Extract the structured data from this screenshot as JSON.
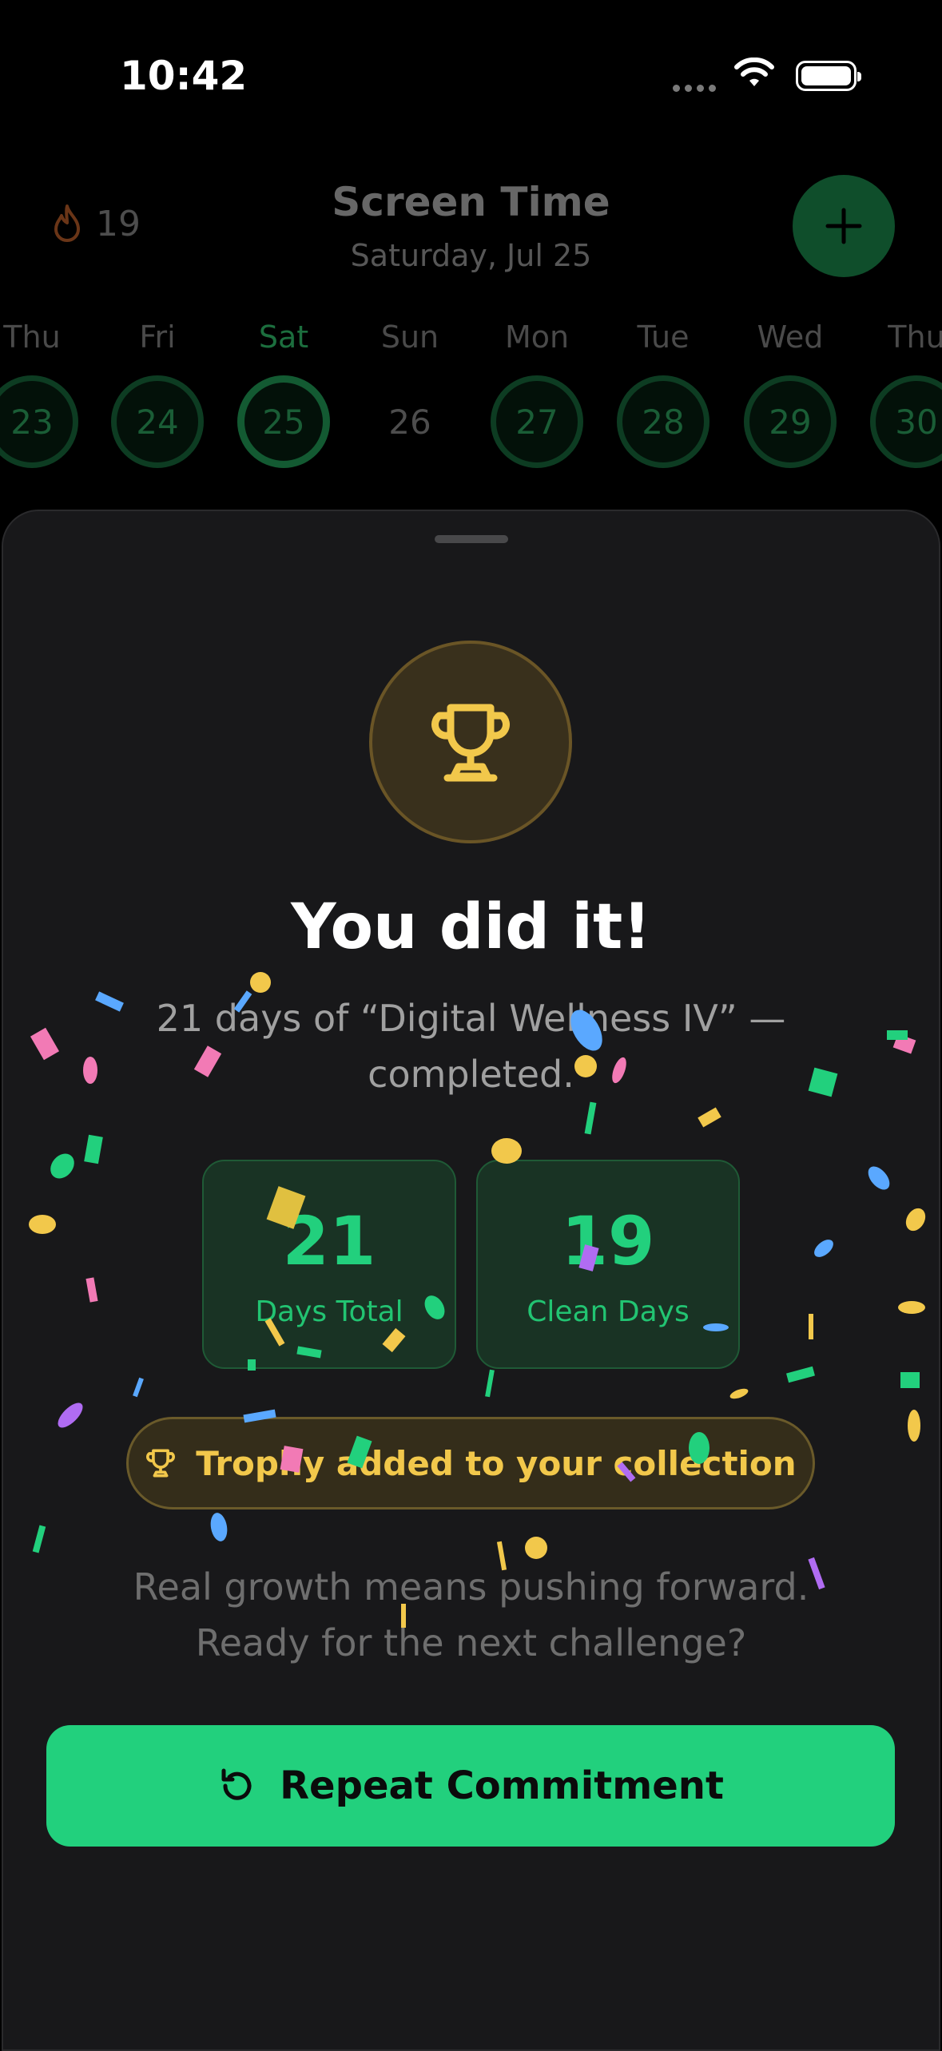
{
  "status_bar": {
    "time": "10:42"
  },
  "header": {
    "streak_count": "19",
    "title": "Screen Time",
    "date": "Saturday, Jul 25"
  },
  "days": [
    {
      "label": "Thu",
      "number": "23"
    },
    {
      "label": "Fri",
      "number": "24"
    },
    {
      "label": "Sat",
      "number": "25",
      "selected": true
    },
    {
      "label": "Sun",
      "number": "26",
      "empty": true
    },
    {
      "label": "Mon",
      "number": "27"
    },
    {
      "label": "Tue",
      "number": "28"
    },
    {
      "label": "Wed",
      "number": "29"
    },
    {
      "label": "Thu",
      "number": "30"
    }
  ],
  "sheet": {
    "title": "You did it!",
    "subtitle": "21 days of “Digital Wellness IV” — completed.",
    "stats": [
      {
        "value": "21",
        "label": "Days Total"
      },
      {
        "value": "19",
        "label": "Clean Days"
      }
    ],
    "trophy_notice": "Trophy added to your collection",
    "motivation": "Real growth means pushing forward. Ready for the next challenge?",
    "cta_label": "Repeat Commitment"
  },
  "colors": {
    "accent_green": "#22d07d",
    "trophy_gold": "#f2c84b",
    "sheet_bg": "#18181a"
  },
  "icons": [
    "flame-icon",
    "plus-icon",
    "trophy-icon",
    "repeat-icon",
    "wifi-icon",
    "battery-icon"
  ]
}
